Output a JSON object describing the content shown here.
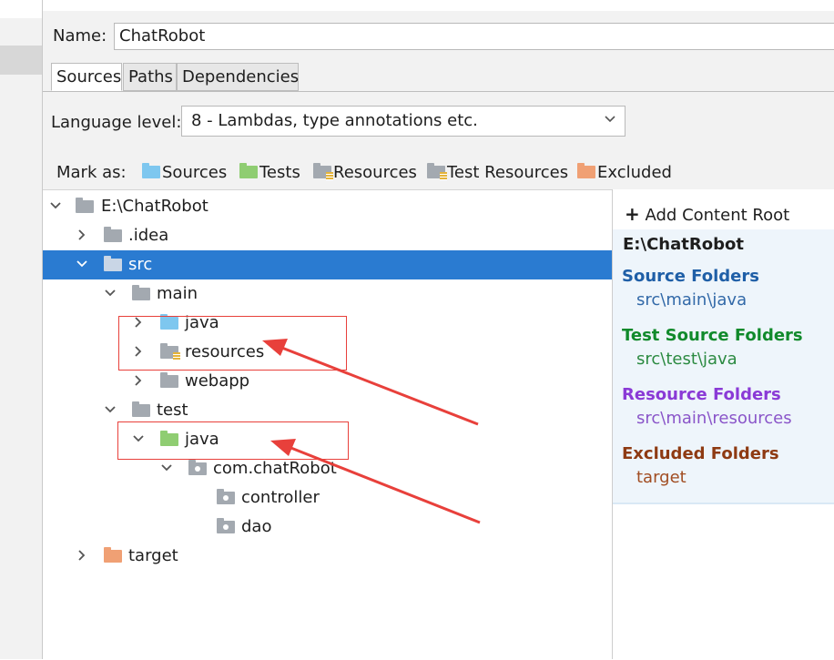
{
  "name_field": {
    "label": "Name:",
    "value": "ChatRobot"
  },
  "tabs": [
    {
      "label": "Sources"
    },
    {
      "label": "Paths"
    },
    {
      "label": "Dependencies"
    }
  ],
  "language_level": {
    "label": "Language level:",
    "value": "8 - Lambdas, type annotations etc."
  },
  "mark_as": {
    "label": "Mark as:",
    "items": [
      {
        "label": "Sources",
        "icon": "source-folder-icon",
        "color": "#7ec7ef"
      },
      {
        "label": "Tests",
        "icon": "test-folder-icon",
        "color": "#8fcd72"
      },
      {
        "label": "Resources",
        "icon": "resources-folder-icon",
        "color": "#a3a9b0"
      },
      {
        "label": "Test Resources",
        "icon": "test-resources-folder-icon",
        "color": "#a3a9b0"
      },
      {
        "label": "Excluded",
        "icon": "excluded-folder-icon",
        "color": "#f0a074"
      }
    ]
  },
  "tree": [
    {
      "label": "E:\\ChatRobot",
      "expanded": true,
      "icon": "folder-icon"
    },
    {
      "label": ".idea",
      "expanded": false,
      "icon": "folder-icon"
    },
    {
      "label": "src",
      "expanded": true,
      "icon": "folder-icon",
      "selected": true
    },
    {
      "label": "main",
      "expanded": true,
      "icon": "folder-icon"
    },
    {
      "label": "java",
      "expanded": false,
      "icon": "source-folder-icon"
    },
    {
      "label": "resources",
      "expanded": false,
      "icon": "resources-folder-icon"
    },
    {
      "label": "webapp",
      "expanded": false,
      "icon": "folder-icon"
    },
    {
      "label": "test",
      "expanded": true,
      "icon": "folder-icon"
    },
    {
      "label": "java",
      "expanded": true,
      "icon": "test-folder-icon"
    },
    {
      "label": "com.chatRobot",
      "expanded": true,
      "icon": "package-icon"
    },
    {
      "label": "controller",
      "icon": "package-icon"
    },
    {
      "label": "dao",
      "icon": "package-icon"
    },
    {
      "label": "target",
      "expanded": false,
      "icon": "excluded-folder-icon"
    }
  ],
  "content_root": {
    "add_label": "Add Content Root",
    "path": "E:\\ChatRobot",
    "sections": [
      {
        "title": "Source Folders",
        "item": "src\\main\\java",
        "title_color": "#1f5fa7",
        "item_color": "#3269a8"
      },
      {
        "title": "Test Source Folders",
        "item": "src\\test\\java",
        "title_color": "#118a2b",
        "item_color": "#2b8a41"
      },
      {
        "title": "Resource Folders",
        "item": "src\\main\\resources",
        "title_color": "#8a3ad6",
        "item_color": "#8a55c9"
      },
      {
        "title": "Excluded Folders",
        "item": "target",
        "title_color": "#8e3a12",
        "item_color": "#a14d22"
      }
    ]
  }
}
